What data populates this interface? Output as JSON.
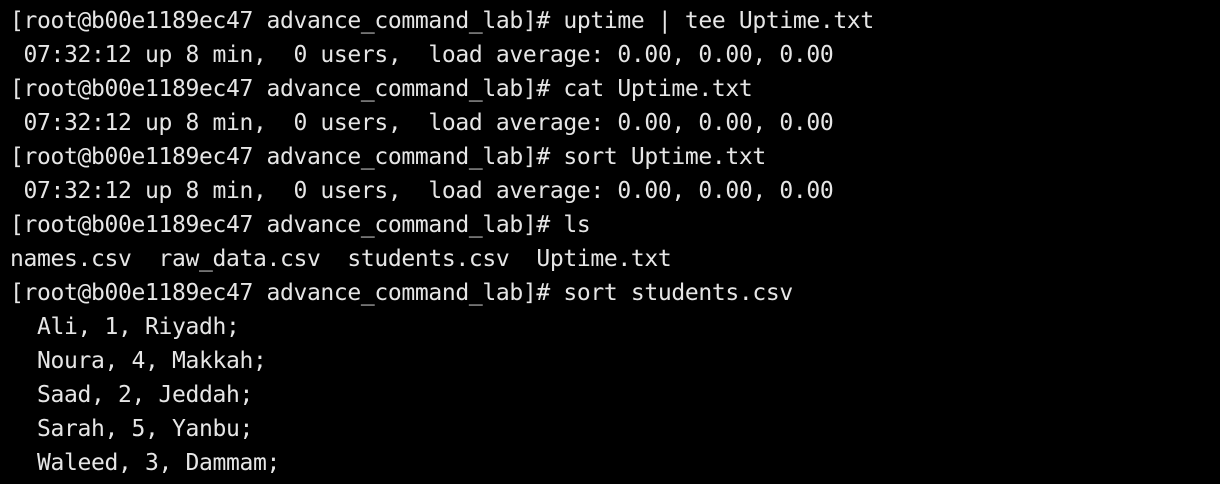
{
  "terminal": {
    "background": "#000000",
    "foreground": "#e6e6e6",
    "lines": [
      "[root@b00e1189ec47 advance_command_lab]# uptime | tee Uptime.txt",
      " 07:32:12 up 8 min,  0 users,  load average: 0.00, 0.00, 0.00",
      "[root@b00e1189ec47 advance_command_lab]# cat Uptime.txt",
      " 07:32:12 up 8 min,  0 users,  load average: 0.00, 0.00, 0.00",
      "[root@b00e1189ec47 advance_command_lab]# sort Uptime.txt",
      " 07:32:12 up 8 min,  0 users,  load average: 0.00, 0.00, 0.00",
      "[root@b00e1189ec47 advance_command_lab]# ls",
      "names.csv  raw_data.csv  students.csv  Uptime.txt",
      "[root@b00e1189ec47 advance_command_lab]# sort students.csv",
      "  Ali, 1, Riyadh;",
      "  Noura, 4, Makkah;",
      "  Saad, 2, Jeddah;",
      "  Sarah, 5, Yanbu;",
      "  Waleed, 3, Dammam;"
    ]
  }
}
